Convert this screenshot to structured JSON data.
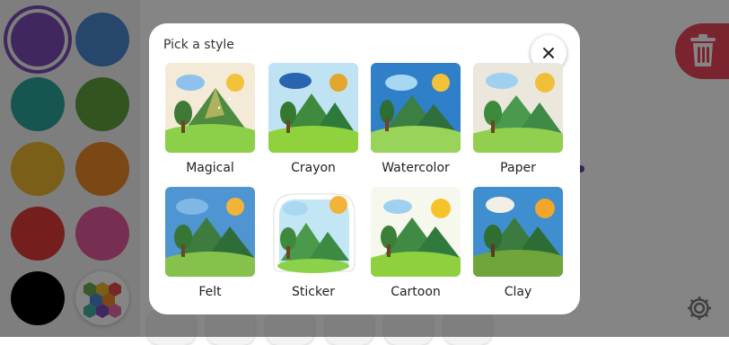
{
  "palette": {
    "colors": [
      {
        "hex": "#7d4bb6",
        "selected": true
      },
      {
        "hex": "#4a86cf",
        "selected": false
      },
      {
        "hex": "#2ca59a",
        "selected": false
      },
      {
        "hex": "#5fa13f",
        "selected": false
      },
      {
        "hex": "#e9b62d",
        "selected": false
      },
      {
        "hex": "#ec8a2a",
        "selected": false
      },
      {
        "hex": "#df3b3a",
        "selected": false
      },
      {
        "hex": "#e25a9b",
        "selected": false
      },
      {
        "hex": "#000000",
        "selected": false
      }
    ],
    "more_icon": "color-wheel-icon"
  },
  "toolbar": {
    "trash_icon": "trash-icon",
    "settings_icon": "gear-icon"
  },
  "modal": {
    "title": "Pick a style",
    "close_icon": "close-icon",
    "styles": [
      {
        "label": "Magical"
      },
      {
        "label": "Crayon"
      },
      {
        "label": "Watercolor"
      },
      {
        "label": "Paper"
      },
      {
        "label": "Felt"
      },
      {
        "label": "Sticker"
      },
      {
        "label": "Cartoon"
      },
      {
        "label": "Clay"
      }
    ]
  }
}
